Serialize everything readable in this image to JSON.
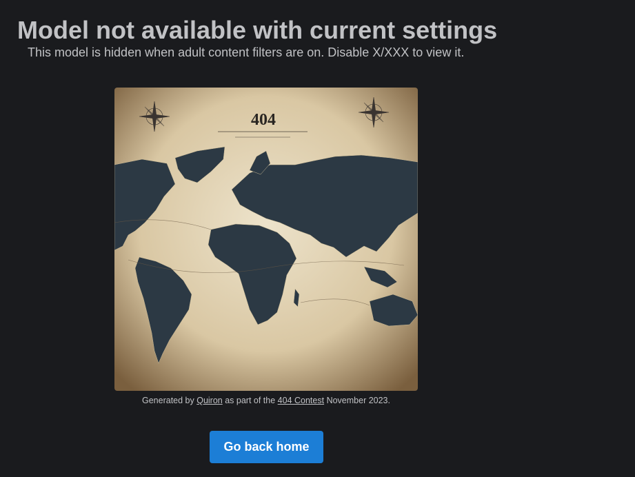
{
  "heading": {
    "title": "Model not available with current settings",
    "subtitle": "This model is hidden when adult content filters are on. Disable X/XXX to view it."
  },
  "illustration": {
    "heading": "404",
    "colors": {
      "parchment": "#e9dcc0",
      "land": "#2c3944"
    }
  },
  "caption": {
    "prefix": "Generated by ",
    "author": "Quiron",
    "middle": " as part of the ",
    "contest": "404 Contest",
    "suffix": " November 2023."
  },
  "actions": {
    "home_label": "Go back home"
  },
  "colors": {
    "background": "#1a1b1e",
    "text": "#c1c2c5",
    "accent": "#1c7ed6"
  }
}
